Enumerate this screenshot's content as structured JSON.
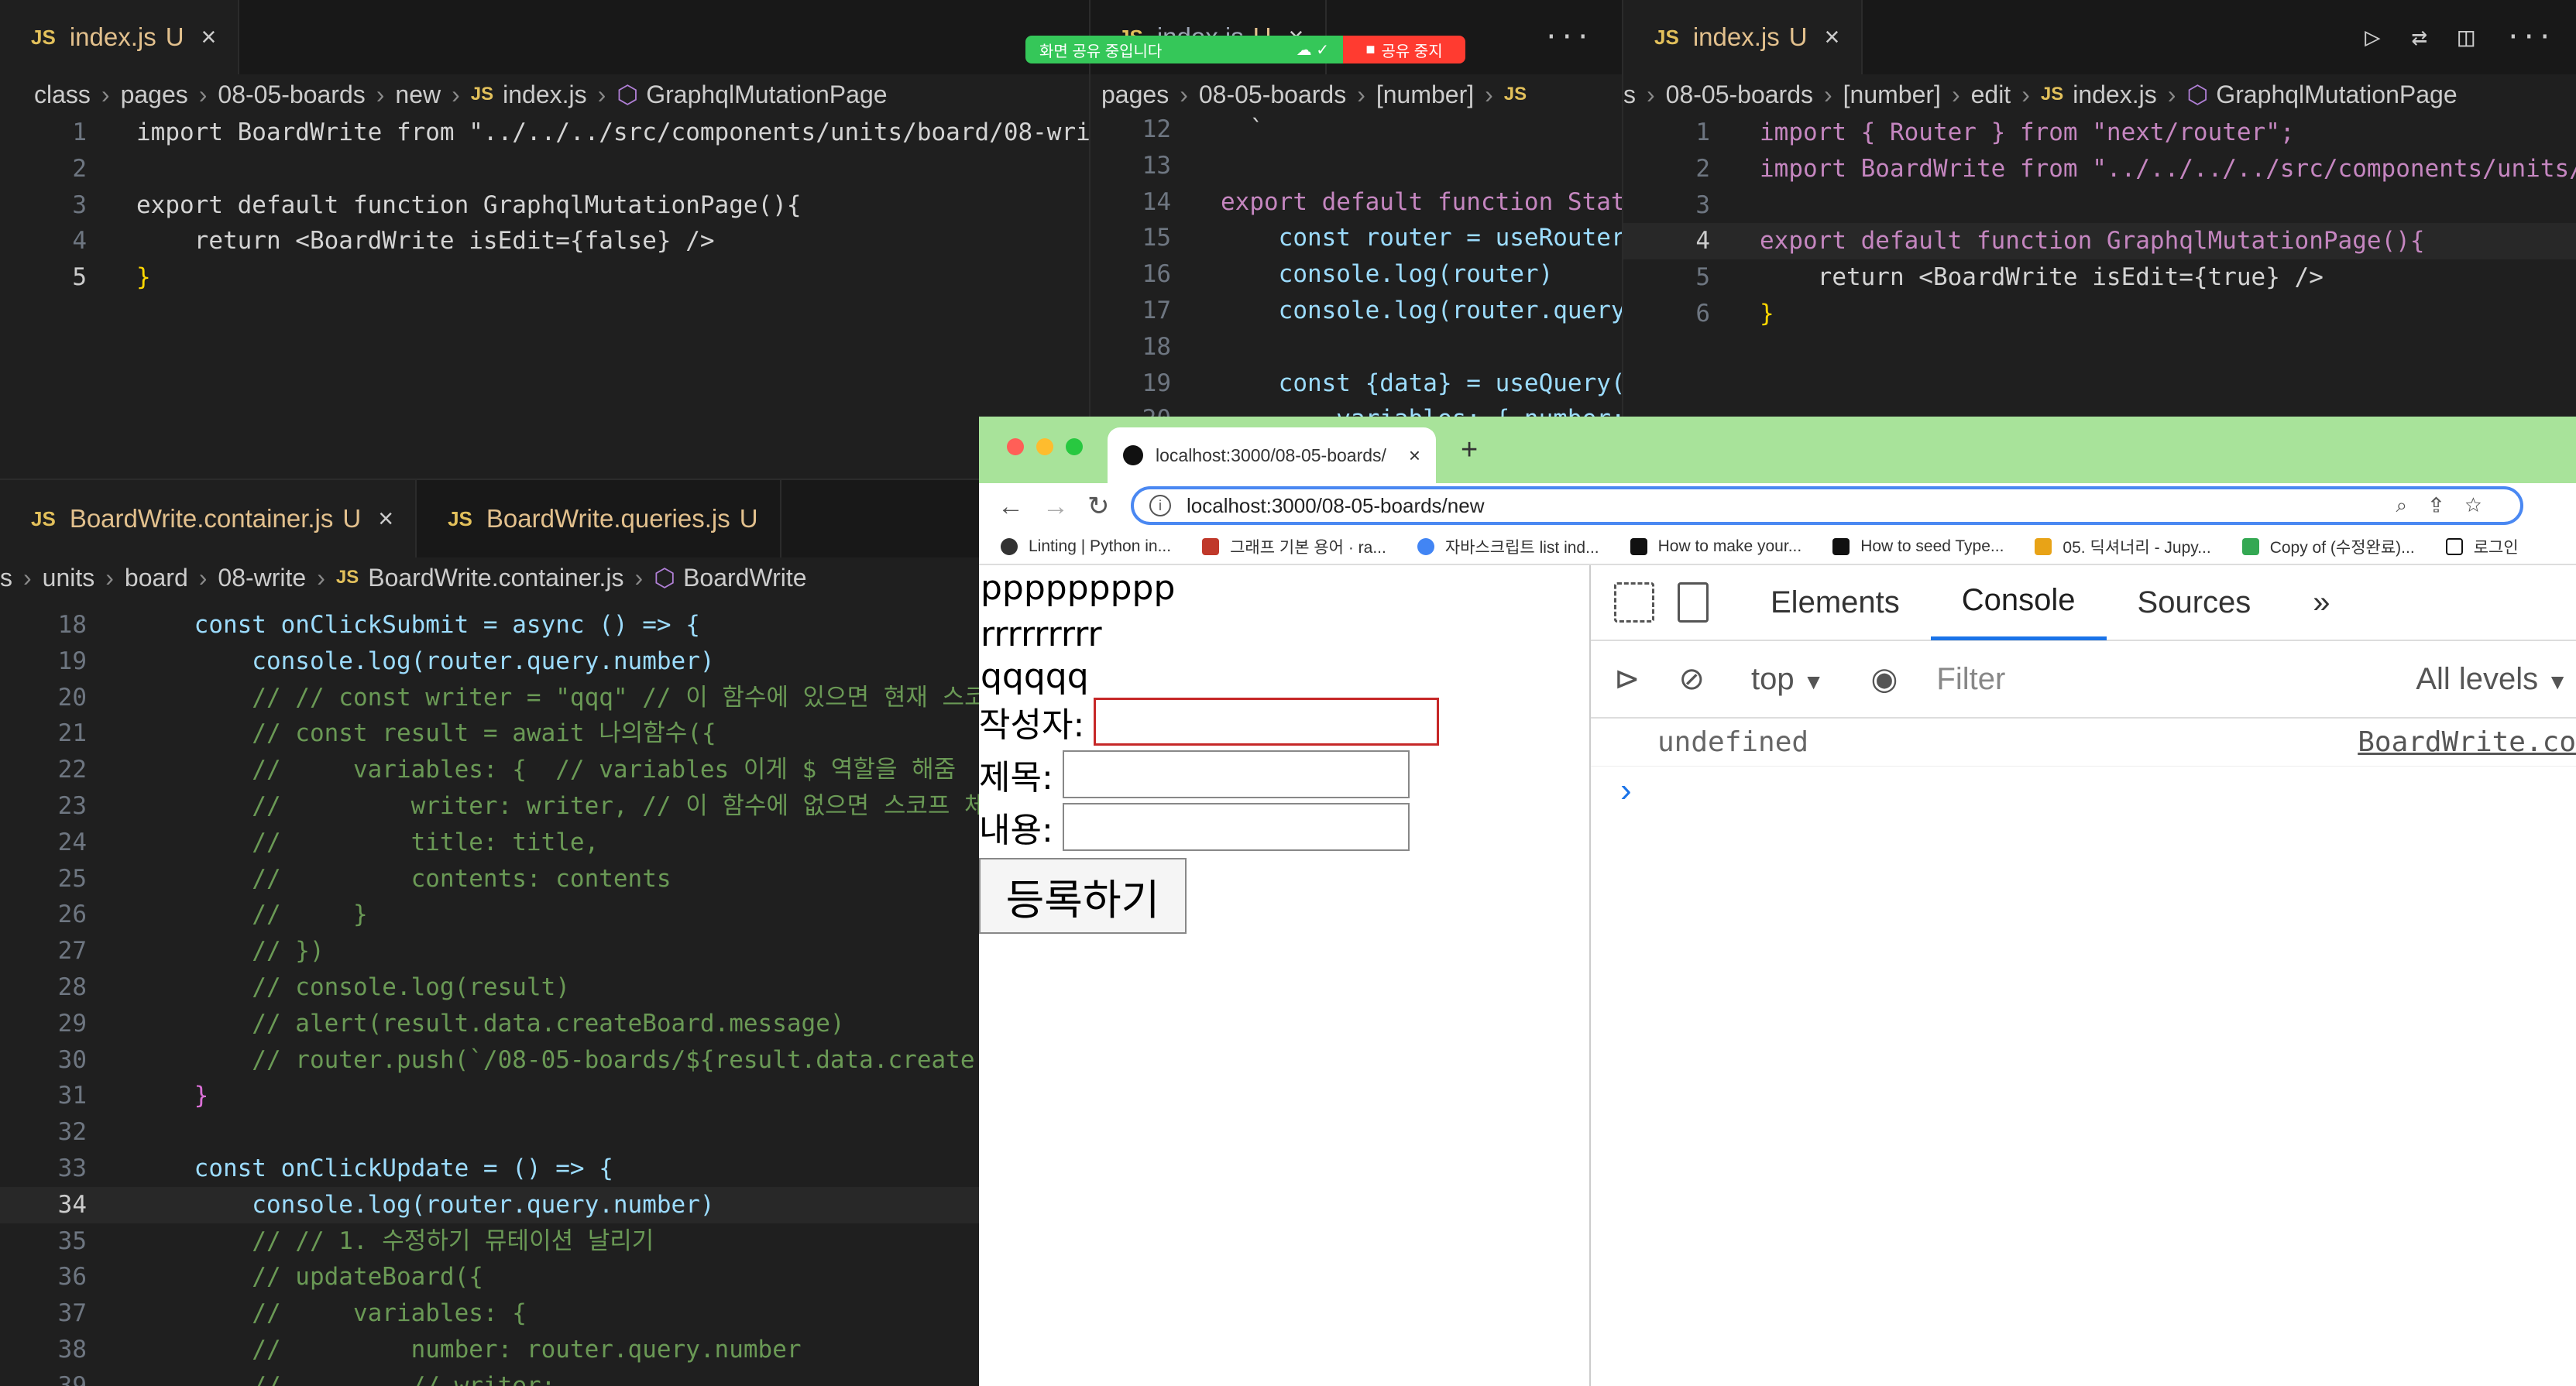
{
  "screen_share": {
    "status": "화면 공유 중입니다",
    "stop": "공유 중지"
  },
  "editor_left_top": {
    "tab": {
      "name": "index.js",
      "modified": "U"
    },
    "breadcrumbs": [
      "class",
      "pages",
      "08-05-boards",
      "new",
      "index.js",
      "GraphqlMutationPage"
    ],
    "lines": [
      {
        "n": "1",
        "code": "import BoardWrite from \"../../../src/components/units/board/08-wri"
      },
      {
        "n": "2",
        "code": ""
      },
      {
        "n": "3",
        "code": "export default function GraphqlMutationPage(){"
      },
      {
        "n": "4",
        "code": "    return <BoardWrite isEdit={false} />"
      },
      {
        "n": "5",
        "code": "}"
      }
    ]
  },
  "editor_middle_top": {
    "tab": {
      "name": "index.js",
      "modified": "U"
    },
    "breadcrumbs": [
      "pages",
      "08-05-boards",
      "[number]"
    ],
    "lines": [
      {
        "n": "12",
        "code": "  `"
      },
      {
        "n": "13",
        "code": ""
      },
      {
        "n": "14",
        "code": "export default function Stat"
      },
      {
        "n": "15",
        "code": "    const router = useRouter"
      },
      {
        "n": "16",
        "code": "    console.log(router)"
      },
      {
        "n": "17",
        "code": "    console.log(router.query"
      },
      {
        "n": "18",
        "code": ""
      },
      {
        "n": "19",
        "code": "    const {data} = useQuery("
      },
      {
        "n": "20",
        "code": "        variables: { number:"
      }
    ]
  },
  "editor_right_top": {
    "tab": {
      "name": "index.js",
      "modified": "U"
    },
    "breadcrumbs": [
      "s",
      "08-05-boards",
      "[number]",
      "edit",
      "index.js",
      "GraphqlMutationPage"
    ],
    "lines": [
      {
        "n": "1",
        "code": "import { Router } from \"next/router\";"
      },
      {
        "n": "2",
        "code": "import BoardWrite from \"../../../../src/components/units/"
      },
      {
        "n": "3",
        "code": ""
      },
      {
        "n": "4",
        "code": "export default function GraphqlMutationPage(){"
      },
      {
        "n": "5",
        "code": "    return <BoardWrite isEdit={true} />"
      },
      {
        "n": "6",
        "code": "}"
      }
    ]
  },
  "editor_bottom": {
    "tabs": [
      {
        "name": "BoardWrite.container.js",
        "modified": "U"
      },
      {
        "name": "BoardWrite.queries.js",
        "modified": "U"
      }
    ],
    "breadcrumbs": [
      "s",
      "units",
      "board",
      "08-write",
      "BoardWrite.container.js",
      "BoardWrite"
    ],
    "lines": [
      {
        "n": "18",
        "code": "    const onClickSubmit = async () => {"
      },
      {
        "n": "19",
        "code": "        console.log(router.query.number)"
      },
      {
        "n": "20",
        "code": "        // // const writer = \"qqq\" // 이 함수에 있으면 현재 스코"
      },
      {
        "n": "21",
        "code": "        // const result = await 나의함수({"
      },
      {
        "n": "22",
        "code": "        //     variables: {  // variables 이게 $ 역할을 해줌"
      },
      {
        "n": "23",
        "code": "        //         writer: writer, // 이 함수에 없으면 스코프 체"
      },
      {
        "n": "24",
        "code": "        //         title: title,"
      },
      {
        "n": "25",
        "code": "        //         contents: contents"
      },
      {
        "n": "26",
        "code": "        //     }"
      },
      {
        "n": "27",
        "code": "        // })"
      },
      {
        "n": "28",
        "code": "        // console.log(result)"
      },
      {
        "n": "29",
        "code": "        // alert(result.data.createBoard.message)"
      },
      {
        "n": "30",
        "code": "        // router.push(`/08-05-boards/${result.data.create"
      },
      {
        "n": "31",
        "code": "    }"
      },
      {
        "n": "32",
        "code": ""
      },
      {
        "n": "33",
        "code": "    const onClickUpdate = () => {"
      },
      {
        "n": "34",
        "code": "        console.log(router.query.number)"
      },
      {
        "n": "35",
        "code": "        // // 1. 수정하기 뮤테이션 날리기"
      },
      {
        "n": "36",
        "code": "        // updateBoard({"
      },
      {
        "n": "37",
        "code": "        //     variables: {"
      },
      {
        "n": "38",
        "code": "        //         number: router.query.number"
      },
      {
        "n": "39",
        "code": "        //         // writer:"
      }
    ]
  },
  "browser": {
    "tab_title": "localhost:3000/08-05-boards/",
    "url": "localhost:3000/08-05-boards/new",
    "bookmarks": [
      "Linting | Python in...",
      "그래프 기본 용어 · ra...",
      "자바스크립트 list ind...",
      "How to make your...",
      "How to seed Type...",
      "05. 딕셔너리 - Jupy...",
      "Copy of (수정완료)...",
      "로그인"
    ],
    "page": {
      "line1": "ppppppppp",
      "line2": "rrrrrrrrr",
      "line3": "qqqqq",
      "writer_label": "작성자:",
      "title_label": "제목:",
      "contents_label": "내용:",
      "submit_label": "등록하기"
    },
    "devtools": {
      "tabs": [
        "Elements",
        "Console",
        "Sources",
        "»"
      ],
      "context": "top",
      "filter_placeholder": "Filter",
      "levels": "All levels",
      "log_value": "undefined",
      "log_source": "BoardWrite.co",
      "prompt": "›"
    }
  }
}
